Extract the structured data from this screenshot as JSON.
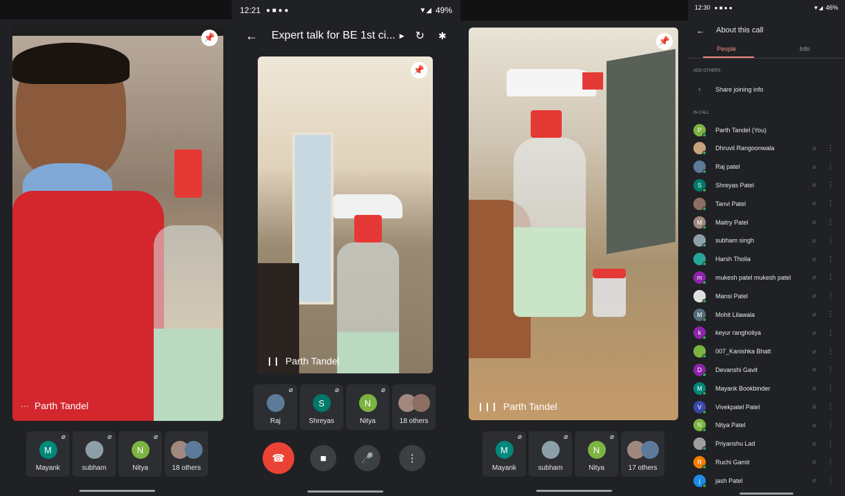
{
  "panel1": {
    "speaker_name": "Parth Tandel",
    "thumbs": [
      {
        "initial": "M",
        "name": "Mayank",
        "color": "#00897b"
      },
      {
        "initial": "",
        "name": "subham",
        "color": "#8d9fa8"
      },
      {
        "initial": "N",
        "name": "Nitya",
        "color": "#7cb342"
      },
      {
        "initial": "",
        "name": "18 others",
        "color": "#a1887f"
      }
    ]
  },
  "panel2": {
    "status": {
      "time": "12:21",
      "battery": "49%"
    },
    "meeting_title": "Expert talk for BE 1st ci...",
    "speaker_name": "Parth Tandel",
    "thumbs": [
      {
        "initial": "",
        "name": "Raj",
        "color": "#5c7a99"
      },
      {
        "initial": "S",
        "name": "Shreyas",
        "color": "#00796b"
      },
      {
        "initial": "N",
        "name": "Nitya",
        "color": "#7cb342"
      },
      {
        "initial": "",
        "name": "18 others",
        "color": "#a1887f"
      }
    ]
  },
  "panel3": {
    "speaker_name": "Parth Tandel",
    "thumbs": [
      {
        "initial": "M",
        "name": "Mayank",
        "color": "#00897b"
      },
      {
        "initial": "",
        "name": "subham",
        "color": "#8d9fa8"
      },
      {
        "initial": "N",
        "name": "Nitya",
        "color": "#7cb342"
      },
      {
        "initial": "",
        "name": "17 others",
        "color": "#a1887f"
      }
    ]
  },
  "panel4": {
    "status": {
      "time": "12:30",
      "battery": "46%"
    },
    "title": "About this call",
    "tabs": {
      "people": "People",
      "info": "Info"
    },
    "add_others_header": "ADD OTHERS",
    "share_label": "Share joining info",
    "in_call_header": "IN CALL",
    "people": [
      {
        "initial": "P",
        "name": "Parth Tandel (You)",
        "color": "#7cb342",
        "self": true
      },
      {
        "initial": "",
        "name": "Dhruvil Rangoonwala",
        "color": "#c8a27a"
      },
      {
        "initial": "",
        "name": "Raj patel",
        "color": "#5c7a99"
      },
      {
        "initial": "S",
        "name": "Shreyas Patel",
        "color": "#00796b"
      },
      {
        "initial": "",
        "name": "Tanvi Patel",
        "color": "#8d6e63"
      },
      {
        "initial": "M",
        "name": "Maitry Patel",
        "color": "#a1887f"
      },
      {
        "initial": "",
        "name": "subham singh",
        "color": "#8d9fa8"
      },
      {
        "initial": "",
        "name": "Harsh Tholia",
        "color": "#26a69a"
      },
      {
        "initial": "m",
        "name": "mukesh patel mukesh patel",
        "color": "#8e24aa"
      },
      {
        "initial": "",
        "name": "Mansi Patel",
        "color": "#e0e0e0"
      },
      {
        "initial": "M",
        "name": "Mohit Lilawala",
        "color": "#546e7a"
      },
      {
        "initial": "k",
        "name": "keyur rangholiya",
        "color": "#8e24aa"
      },
      {
        "initial": "",
        "name": "007_Kanishka Bhatt",
        "color": "#7cb342"
      },
      {
        "initial": "D",
        "name": "Devanshi Gavit",
        "color": "#8e24aa"
      },
      {
        "initial": "M",
        "name": "Mayank Bookbinder",
        "color": "#00897b"
      },
      {
        "initial": "V",
        "name": "Vivekpatel Patel",
        "color": "#3949ab"
      },
      {
        "initial": "N",
        "name": "Nitya Patel",
        "color": "#7cb342"
      },
      {
        "initial": "",
        "name": "Priyanshu Lad",
        "color": "#9e9e9e"
      },
      {
        "initial": "R",
        "name": "Ruchi Gamit",
        "color": "#f57c00"
      },
      {
        "initial": "j",
        "name": "jash Patel",
        "color": "#1e88e5"
      }
    ]
  }
}
